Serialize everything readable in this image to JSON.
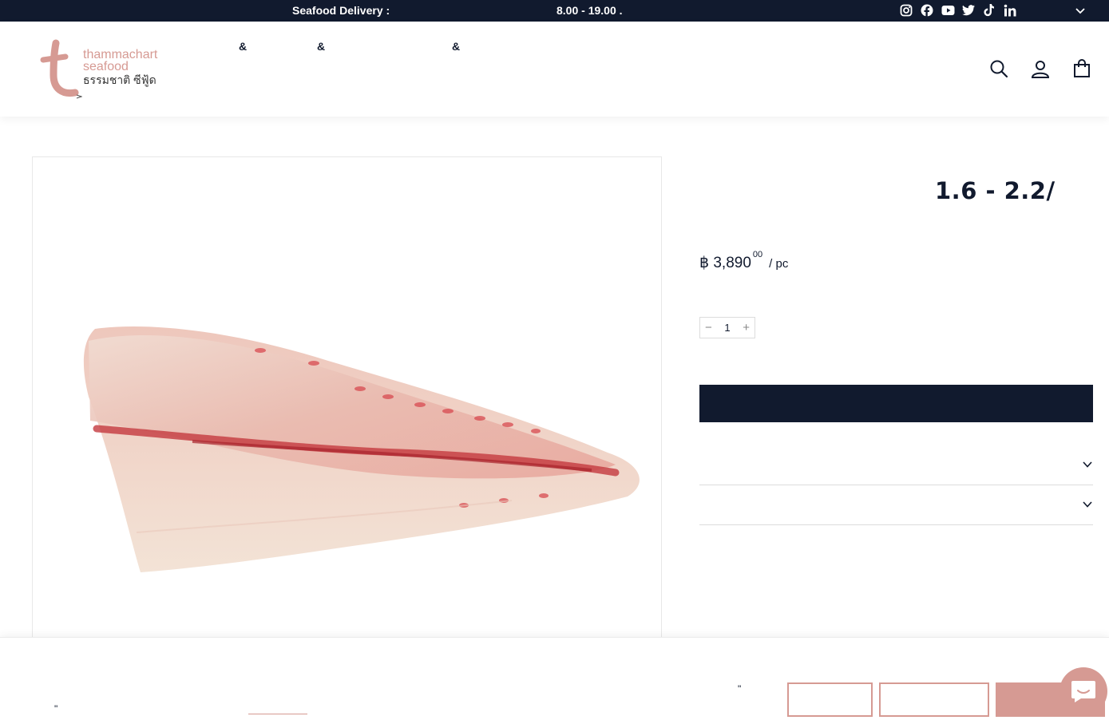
{
  "announcement": {
    "left_text": "Seafood Delivery :",
    "right_text": "8.00 - 19.00  ."
  },
  "social_icons": [
    "instagram-icon",
    "facebook-icon",
    "youtube-icon",
    "twitter-icon",
    "tiktok-icon",
    "linkedin-icon"
  ],
  "logo": {
    "line1": "thammachart",
    "line2": "seafood",
    "line3": "ธรรมชาติ ซีฟู้ด"
  },
  "nav": {
    "items": [
      "&",
      "&",
      "&"
    ]
  },
  "header_icons": [
    "search-icon",
    "account-icon",
    "cart-icon"
  ],
  "product": {
    "title": "1.6 - 2.2/",
    "price_main": "฿ 3,890",
    "price_cents": "00",
    "price_unit": "/ pc",
    "quantity": "1",
    "minus": "−",
    "plus": "+"
  },
  "cookie": {
    "quote_left": "\"",
    "quote_right": "\""
  },
  "colors": {
    "navy": "#111a2e",
    "brand_pink": "#d69a93"
  }
}
